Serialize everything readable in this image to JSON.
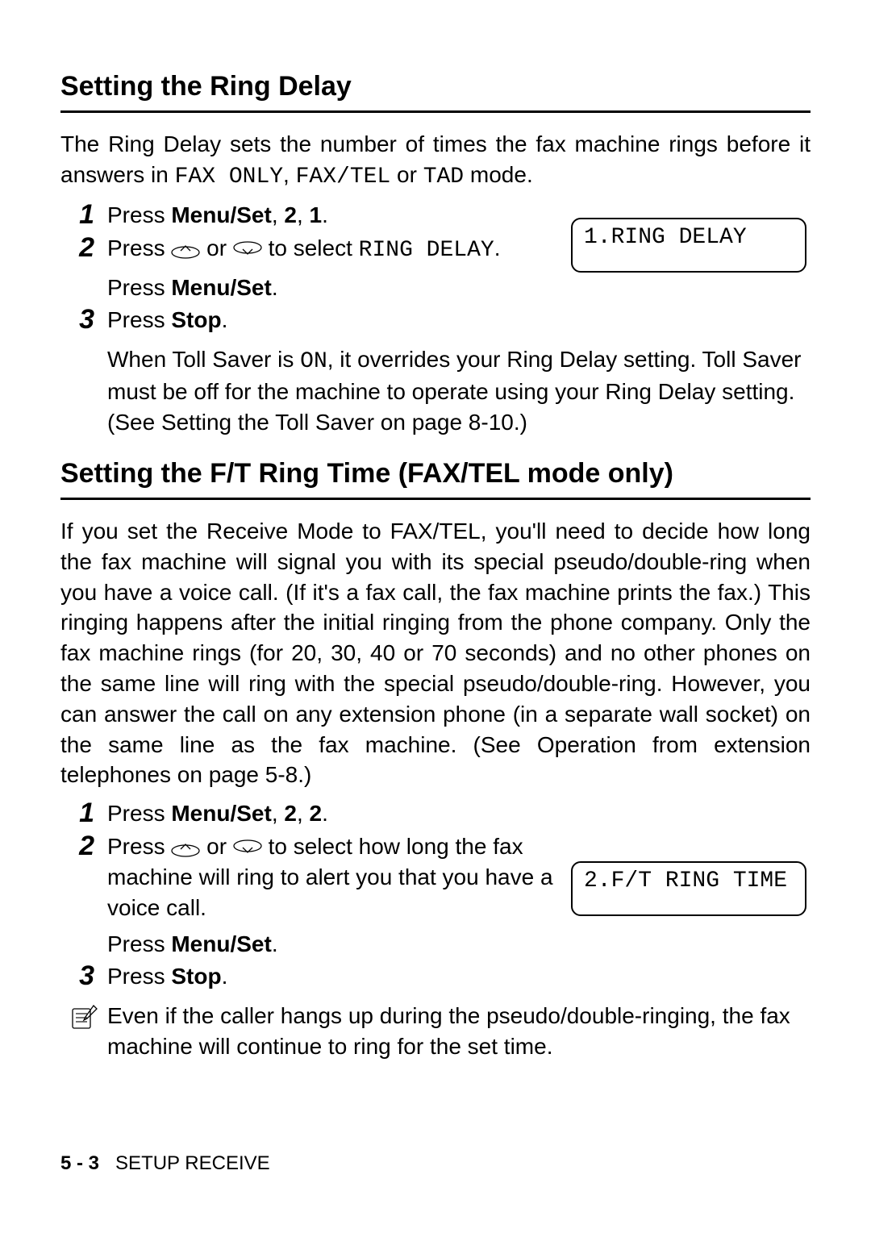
{
  "section1": {
    "heading": "Setting the Ring Delay",
    "intro_pre": "The Ring Delay sets the number of times the fax machine rings before it answers in ",
    "mode1": "FAX ONLY",
    "intro_mid1": ", ",
    "mode2": "FAX/TEL",
    "intro_mid2": " or ",
    "mode3": "TAD",
    "intro_post": " mode.",
    "step1_num": "1",
    "step1_a": "Press ",
    "step1_b": "Menu/Set",
    "step1_c": ", ",
    "step1_d": "2",
    "step1_e": ", ",
    "step1_f": "1",
    "step1_g": ".",
    "step2_num": "2",
    "step2_a": "Press ",
    "step2_b": " or ",
    "step2_c": " to select ",
    "step2_d": "RING DELAY",
    "step2_e": ".",
    "step2_press_a": "Press ",
    "step2_press_b": "Menu/Set",
    "step2_press_c": ".",
    "step3_num": "3",
    "step3_a": "Press ",
    "step3_b": "Stop",
    "step3_c": ".",
    "toll_a": "When Toll Saver is ",
    "toll_on": "ON",
    "toll_b": ", it overrides your Ring Delay setting. Toll Saver must be off for the machine to operate using your Ring Delay setting. (See ",
    "toll_ref": "Setting the Toll Saver",
    "toll_c": " on page 8-10.)",
    "lcd": "1.RING DELAY"
  },
  "section2": {
    "heading": "Setting the F/T Ring Time (FAX/TEL mode only)",
    "intro_a": "If you set the Receive Mode to FAX/TEL, you'll need to decide how long the fax machine will signal you with its special pseudo/double-ring when you have a voice call. (If it's a fax call, the fax machine prints the fax.) This ringing happens after the initial ringing from the phone company. Only the fax machine rings (for 20, 30, 40 or 70 seconds) and no other phones on the same line will ring with the special pseudo/double-ring. However, you can answer the call on any extension phone (in a separate wall socket) on the same line as the fax machine. (See ",
    "intro_ref": "Operation from extension telephones",
    "intro_b": " on page 5-8.)",
    "step1_num": "1",
    "step1_a": "Press ",
    "step1_b": "Menu/Set",
    "step1_c": ", ",
    "step1_d": "2",
    "step1_e": ", ",
    "step1_f": "2",
    "step1_g": ".",
    "step2_num": "2",
    "step2_a": "Press ",
    "step2_b": " or ",
    "step2_c": " to select how long the fax machine will ring to alert you that you have a voice call.",
    "step2_press_a": "Press ",
    "step2_press_b": "Menu/Set",
    "step2_press_c": ".",
    "step3_num": "3",
    "step3_a": "Press ",
    "step3_b": "Stop",
    "step3_c": ".",
    "note": "Even if the caller hangs up during the pseudo/double-ringing, the fax machine will continue to ring for the set time.",
    "lcd": "2.F/T RING TIME"
  },
  "footer": {
    "page": "5 - 3",
    "label": "SETUP RECEIVE"
  }
}
